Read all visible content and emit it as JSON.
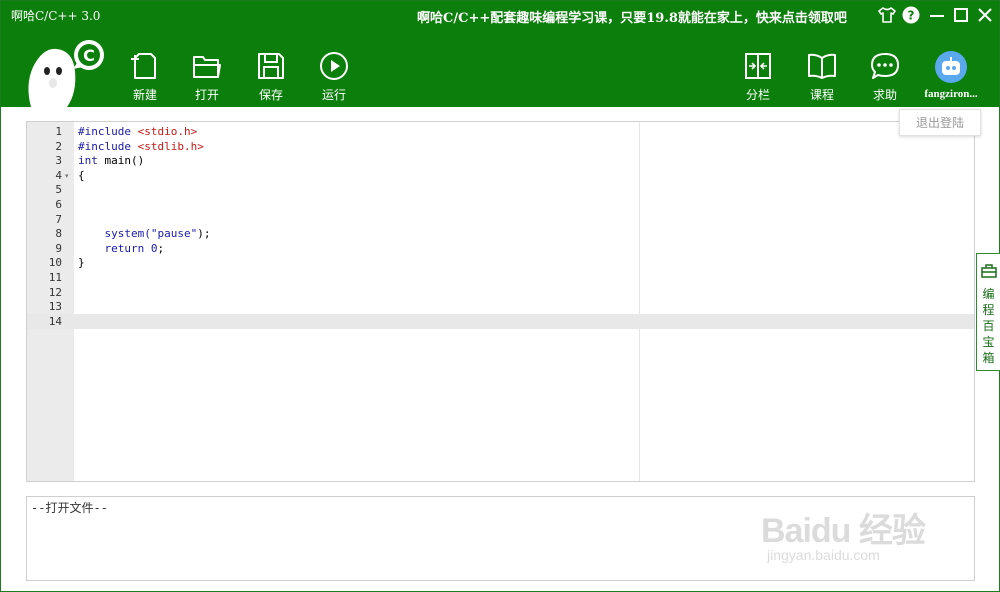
{
  "window": {
    "title": "啊哈C/C++ 3.0",
    "promo": "啊哈C/C++配套趣味编程学习课，只要19.8就能在家上，快来点击领取吧"
  },
  "toolbar": {
    "new_label": "新建",
    "open_label": "打开",
    "save_label": "保存",
    "run_label": "运行",
    "split_label": "分栏",
    "course_label": "课程",
    "help_label": "求助"
  },
  "logo": {
    "badge": "C"
  },
  "user": {
    "name": "fangziron...",
    "logout_label": "退出登陆"
  },
  "editor": {
    "line_numbers": [
      "1",
      "2",
      "3",
      "4",
      "5",
      "6",
      "7",
      "8",
      "9",
      "10",
      "11",
      "12",
      "13",
      "14"
    ],
    "lines": [
      [
        {
          "t": "#include ",
          "c": "kw"
        },
        {
          "t": "<stdio.h>",
          "c": "inc"
        }
      ],
      [
        {
          "t": "#include ",
          "c": "kw"
        },
        {
          "t": "<stdlib.h>",
          "c": "inc"
        }
      ],
      [
        {
          "t": "int",
          "c": "kw"
        },
        {
          "t": " main()",
          "c": ""
        }
      ],
      [
        {
          "t": "{",
          "c": ""
        }
      ],
      [],
      [],
      [],
      [
        {
          "t": "    system(",
          "c": "kw"
        },
        {
          "t": "\"pause\"",
          "c": "str"
        },
        {
          "t": ");",
          "c": ""
        }
      ],
      [
        {
          "t": "    return ",
          "c": "kw"
        },
        {
          "t": "0",
          "c": "str"
        },
        {
          "t": ";",
          "c": ""
        }
      ],
      [
        {
          "t": "}",
          "c": ""
        }
      ],
      [],
      [],
      [],
      []
    ],
    "active_line": 14,
    "fold_line": 4
  },
  "side_tab": {
    "label": "编程百宝箱"
  },
  "output": {
    "text": "--打开文件--"
  },
  "watermark": {
    "brand": "Baidu 经验",
    "url": "jingyan.baidu.com"
  },
  "colors": {
    "header": "#0c7e0c",
    "accent": "#2e8b2e"
  }
}
